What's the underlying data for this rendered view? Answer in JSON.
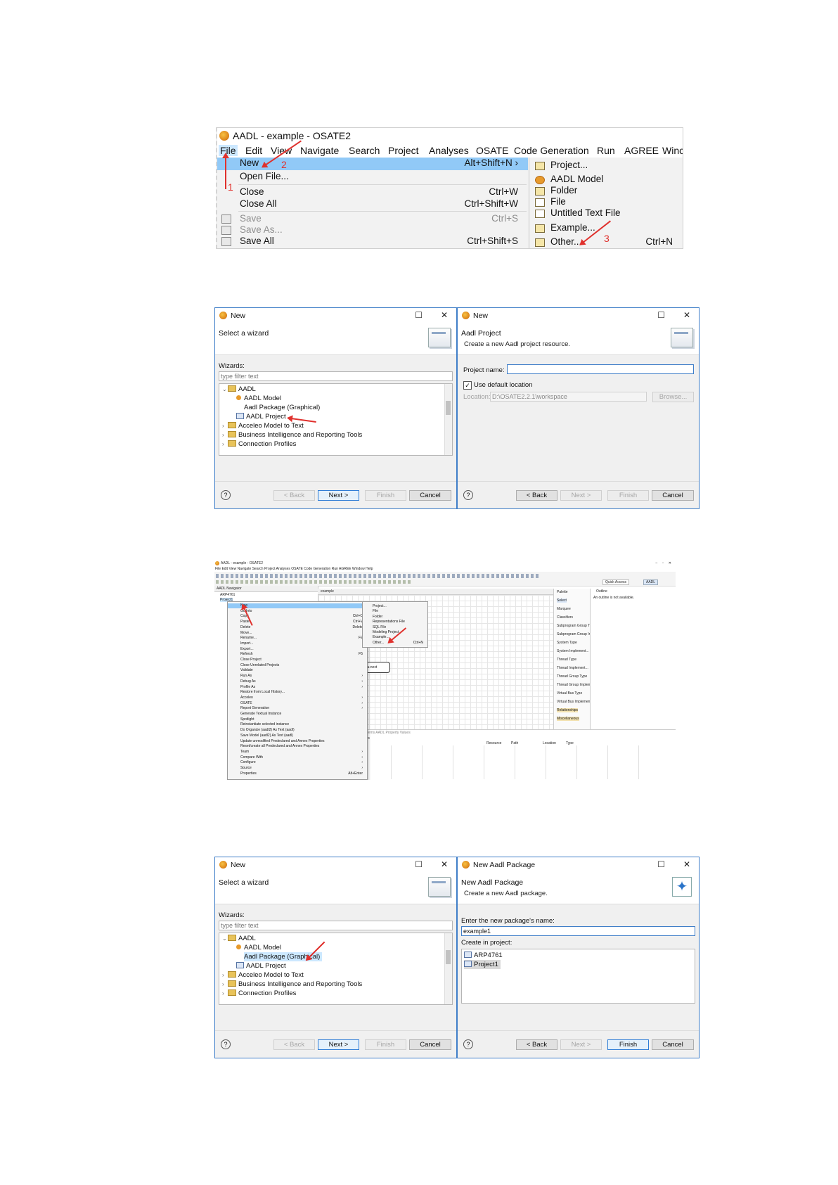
{
  "s1": {
    "title": "AADL - example - OSATE2",
    "menubar": [
      "File",
      "Edit",
      "View",
      "Navigate",
      "Search",
      "Project",
      "Analyses",
      "OSATE",
      "Code Generation",
      "Run",
      "AGREE",
      "Winc"
    ],
    "file_menu": [
      {
        "label": "New",
        "shortcut": "Alt+Shift+N ›"
      },
      {
        "label": "Open File...",
        "shortcut": ""
      },
      {
        "label": "Close",
        "shortcut": "Ctrl+W"
      },
      {
        "label": "Close All",
        "shortcut": "Ctrl+Shift+W"
      },
      {
        "label": "Save",
        "shortcut": "Ctrl+S"
      },
      {
        "label": "Save As...",
        "shortcut": ""
      },
      {
        "label": "Save All",
        "shortcut": "Ctrl+Shift+S"
      }
    ],
    "submenu": [
      {
        "label": "Project...",
        "shortcut": ""
      },
      {
        "label": "AADL Model",
        "shortcut": ""
      },
      {
        "label": "Folder",
        "shortcut": ""
      },
      {
        "label": "File",
        "shortcut": ""
      },
      {
        "label": "Untitled Text File",
        "shortcut": ""
      },
      {
        "label": "Example...",
        "shortcut": ""
      },
      {
        "label": "Other...",
        "shortcut": "Ctrl+N"
      }
    ],
    "annotations": [
      "1",
      "2",
      "3"
    ],
    "colors": {
      "highlight": "#91c9f7",
      "annotation": "#e0312d"
    }
  },
  "wizard": {
    "title": "New",
    "header": "Select a wizard",
    "wizards_label": "Wizards:",
    "filter_placeholder": "type filter text",
    "tree": [
      "AADL",
      "AADL Model",
      "Aadl Package (Graphical)",
      "AADL Project",
      "Acceleo Model to Text",
      "Business Intelligence and Reporting Tools",
      "Connection Profiles"
    ],
    "buttons": {
      "back": "< Back",
      "next": "Next >",
      "finish": "Finish",
      "cancel": "Cancel"
    },
    "help": "?"
  },
  "project_dialog": {
    "title": "New",
    "header": "Aadl Project",
    "subheader": "Create a new Aadl project resource.",
    "name_label": "Project name:",
    "name_value": "",
    "use_default": "Use default location",
    "location_label": "Location:",
    "location_value": "D:\\OSATE2.2.1\\workspace",
    "browse": "Browse...",
    "buttons": {
      "back": "< Back",
      "next": "Next >",
      "finish": "Finish",
      "cancel": "Cancel"
    }
  },
  "workbench": {
    "title": "AADL - example - OSATE2",
    "menubar": "File  Edit  View  Navigate  Search  Project  Analyses  OSATE  Code Generation  Run  AGREE  Window  Help",
    "navigator_tab": "AADL Navigator",
    "editor_tab": "example",
    "tree": [
      "ARP4761",
      "Project1"
    ],
    "context_menu": [
      {
        "label": "New",
        "shortcut": "›"
      },
      {
        "label": "Go Into",
        "shortcut": ""
      },
      {
        "label": "Copy",
        "shortcut": "Ctrl+C"
      },
      {
        "label": "Paste",
        "shortcut": "Ctrl+V"
      },
      {
        "label": "Delete",
        "shortcut": "Delete"
      },
      {
        "label": "Move...",
        "shortcut": ""
      },
      {
        "label": "Rename...",
        "shortcut": "F2"
      },
      {
        "label": "Import...",
        "shortcut": ""
      },
      {
        "label": "Export...",
        "shortcut": ""
      },
      {
        "label": "Refresh",
        "shortcut": "F5"
      },
      {
        "label": "Close Project",
        "shortcut": ""
      },
      {
        "label": "Close Unrelated Projects",
        "shortcut": ""
      },
      {
        "label": "Validate",
        "shortcut": ""
      },
      {
        "label": "Run As",
        "shortcut": "›"
      },
      {
        "label": "Debug As",
        "shortcut": "›"
      },
      {
        "label": "Profile As",
        "shortcut": "›"
      },
      {
        "label": "Restore from Local History...",
        "shortcut": ""
      },
      {
        "label": "Acceleo",
        "shortcut": "›"
      },
      {
        "label": "OSATE",
        "shortcut": "›"
      },
      {
        "label": "Report Generation",
        "shortcut": "›"
      },
      {
        "label": "Generate Textual Instance",
        "shortcut": ""
      },
      {
        "label": "Spotlight",
        "shortcut": ""
      },
      {
        "label": "Reinstantiate selected instance",
        "shortcut": ""
      },
      {
        "label": "Do Organize (aadl2) As Text (aadl)",
        "shortcut": ""
      },
      {
        "label": "Save Model (aadl2) As Text (aadl)",
        "shortcut": ""
      },
      {
        "label": "Update unmodified Predeclared and Annex Properties",
        "shortcut": ""
      },
      {
        "label": "Reset/create all Predeclared and Annex Properties",
        "shortcut": ""
      },
      {
        "label": "Team",
        "shortcut": "›"
      },
      {
        "label": "Compare With",
        "shortcut": "›"
      },
      {
        "label": "Configure",
        "shortcut": "›"
      },
      {
        "label": "Source",
        "shortcut": "›"
      },
      {
        "label": "Properties",
        "shortcut": "Alt+Enter"
      }
    ],
    "new_submenu": [
      "Project...",
      "File",
      "Folder",
      "Representations File",
      "SQL File",
      "Modeling Project",
      "Example...",
      "Other..."
    ],
    "other_shortcut": "Ctrl+N",
    "palette": [
      "Palette",
      "Select",
      "Marquee",
      "Classifiers",
      "Subprogram Group Type",
      "Subprogram Group Implement...",
      "System Type",
      "System Implement...",
      "Thread Type",
      "Thread Implement...",
      "Thread Group Type",
      "Thread Group Implement...",
      "Virtual Bus Type",
      "Virtual Bus Implement...",
      "Relationships",
      "Miscellaneous"
    ],
    "outline_title": "Outline",
    "outline_msg": "An outline is not available.",
    "quick_access": "Quick Access",
    "perspective": "AADL",
    "bottom_tabs": "Problems  AADL Property Values",
    "bottom_cols": [
      "Resource",
      "Path",
      "Location",
      "Type"
    ],
    "bottom_first": "others",
    "diagram_label": "ozunu.next"
  },
  "package_dialog": {
    "title": "New Aadl Package",
    "header": "New Aadl Package",
    "subheader": "Create a new Aadl package.",
    "name_label": "Enter the new package's name:",
    "name_value": "example1",
    "project_label": "Create in project:",
    "projects": [
      "ARP4761",
      "Project1"
    ],
    "buttons": {
      "back": "< Back",
      "next": "Next >",
      "finish": "Finish",
      "cancel": "Cancel"
    }
  }
}
